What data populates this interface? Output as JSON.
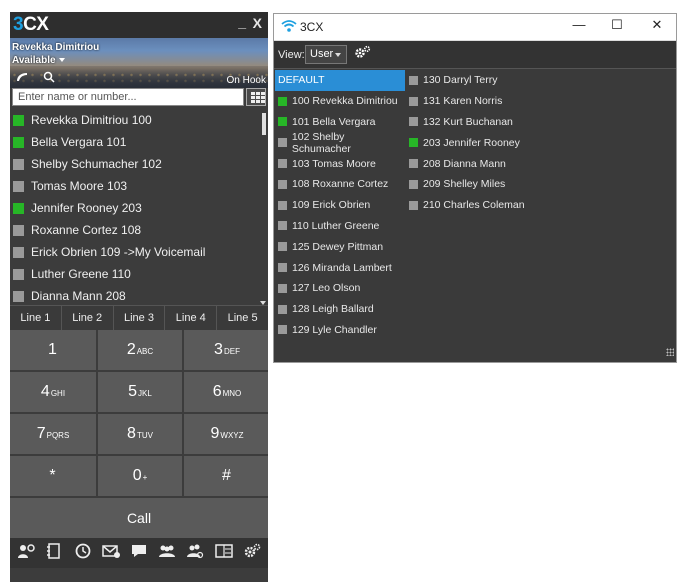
{
  "colors": {
    "available": "#27b627",
    "offline": "#9a9a9a",
    "selected": "#2a8ed6",
    "accent": "#1ea0e0"
  },
  "phone": {
    "logo_prefix": "3",
    "logo_suffix": "CX",
    "minimize": "_",
    "close": "X",
    "user_name": "Revekka Dimitriou",
    "status": "Available",
    "on_hook": "On Hook",
    "search_placeholder": "Enter name or number...",
    "contacts": [
      {
        "label": "Revekka Dimitriou 100",
        "status": "available"
      },
      {
        "label": "Bella Vergara 101",
        "status": "available"
      },
      {
        "label": "Shelby Schumacher 102",
        "status": "offline"
      },
      {
        "label": "Tomas Moore 103",
        "status": "offline"
      },
      {
        "label": "Jennifer Rooney 203",
        "status": "available"
      },
      {
        "label": "Roxanne Cortez 108",
        "status": "offline"
      },
      {
        "label": "Erick Obrien 109 ->My Voicemail",
        "status": "offline"
      },
      {
        "label": "Luther Greene 110",
        "status": "offline"
      },
      {
        "label": "Dianna Mann 208",
        "status": "offline"
      }
    ],
    "lines": [
      "Line 1",
      "Line 2",
      "Line 3",
      "Line 4",
      "Line 5"
    ],
    "keys": [
      {
        "digit": "1",
        "letters": ""
      },
      {
        "digit": "2",
        "letters": "ABC"
      },
      {
        "digit": "3",
        "letters": "DEF"
      },
      {
        "digit": "4",
        "letters": "GHI"
      },
      {
        "digit": "5",
        "letters": "JKL"
      },
      {
        "digit": "6",
        "letters": "MNO"
      },
      {
        "digit": "7",
        "letters": "PQRS"
      },
      {
        "digit": "8",
        "letters": "TUV"
      },
      {
        "digit": "9",
        "letters": "WXYZ"
      },
      {
        "digit": "*",
        "letters": ""
      },
      {
        "digit": "0",
        "letters": "+"
      },
      {
        "digit": "#",
        "letters": ""
      }
    ],
    "call": "Call",
    "toolbar_icons": [
      "add-contact-icon",
      "phonebook-icon",
      "call-history-icon",
      "voicemail-icon",
      "chat-icon",
      "group-icon",
      "conference-icon",
      "presence-window-icon",
      "settings-icon"
    ]
  },
  "presence": {
    "title": "3CX",
    "minimize": "—",
    "maximize": "☐",
    "close": "✕",
    "view_label": "View:",
    "view_value": "User",
    "group": "DEFAULT",
    "column_a": [
      {
        "label": "100 Revekka Dimitriou",
        "status": "available"
      },
      {
        "label": "101 Bella Vergara",
        "status": "available"
      },
      {
        "label": "102 Shelby Schumacher",
        "status": "offline"
      },
      {
        "label": "103 Tomas Moore",
        "status": "offline"
      },
      {
        "label": "108 Roxanne Cortez",
        "status": "offline"
      },
      {
        "label": "109 Erick Obrien",
        "status": "offline"
      },
      {
        "label": "110 Luther Greene",
        "status": "offline"
      },
      {
        "label": "125 Dewey Pittman",
        "status": "offline"
      },
      {
        "label": "126 Miranda Lambert",
        "status": "offline"
      },
      {
        "label": "127 Leo Olson",
        "status": "offline"
      },
      {
        "label": "128 Leigh Ballard",
        "status": "offline"
      },
      {
        "label": "129 Lyle Chandler",
        "status": "offline"
      }
    ],
    "column_b": [
      {
        "label": "130 Darryl Terry",
        "status": "offline"
      },
      {
        "label": "131 Karen Norris",
        "status": "offline"
      },
      {
        "label": "132 Kurt Buchanan",
        "status": "offline"
      },
      {
        "label": "203 Jennifer Rooney",
        "status": "available"
      },
      {
        "label": "208 Dianna Mann",
        "status": "offline"
      },
      {
        "label": "209 Shelley Miles",
        "status": "offline"
      },
      {
        "label": "210 Charles Coleman",
        "status": "offline"
      }
    ]
  }
}
